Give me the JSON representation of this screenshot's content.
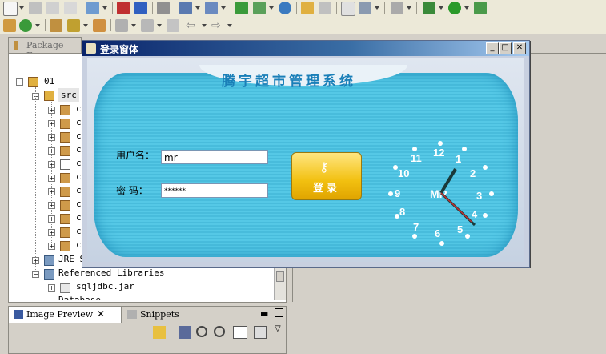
{
  "dialog": {
    "title": "登录窗体",
    "system_title": "腾宇超市管理系统",
    "username_label": "用户名：",
    "username_value": "mr",
    "password_label": "密 码：",
    "password_value": "******",
    "login_button": "登录",
    "clock_brand": "MR",
    "clock_numbers": [
      "12",
      "1",
      "2",
      "3",
      "4",
      "5",
      "6",
      "7",
      "8",
      "9",
      "10",
      "11"
    ]
  },
  "package_explorer": {
    "tab": "Package Exp",
    "project": "01",
    "src": "src",
    "src_items": [
      "co",
      "co",
      "co",
      "co",
      "co",
      "co",
      "co",
      "co",
      "co",
      "co",
      "co"
    ],
    "jre": "JRE S",
    "referenced": "Referenced Libraries",
    "jar": "sqljdbc.jar",
    "next": "Database"
  },
  "bottom_tabs": {
    "image_preview": "Image Preview",
    "snippets": "Snippets"
  },
  "colors": {
    "titlebar": "#0a246a",
    "banner": "#55c8e6",
    "button": "#f2c010"
  }
}
